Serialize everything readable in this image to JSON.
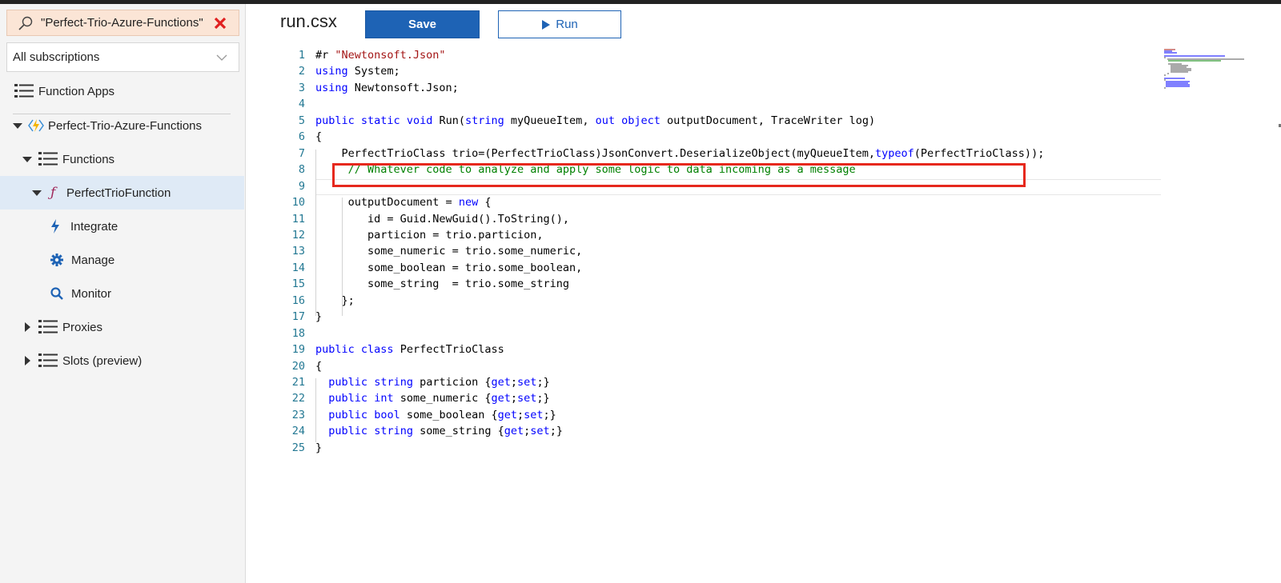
{
  "sidebar": {
    "search_value": "\"Perfect-Trio-Azure-Functions\"",
    "subscriptions": "All subscriptions",
    "items": [
      {
        "label": "Function Apps"
      },
      {
        "label": "Perfect-Trio-Azure-Functions"
      },
      {
        "label": "Functions"
      },
      {
        "label": "PerfectTrioFunction"
      },
      {
        "label": "Integrate"
      },
      {
        "label": "Manage"
      },
      {
        "label": "Monitor"
      },
      {
        "label": "Proxies"
      },
      {
        "label": "Slots (preview)"
      }
    ]
  },
  "editor": {
    "filename": "run.csx",
    "save_label": "Save",
    "run_label": "Run",
    "lines": [
      {
        "n": "1",
        "t": "#r \"Newtonsoft.Json\""
      },
      {
        "n": "2",
        "t": "using System;"
      },
      {
        "n": "3",
        "t": "using Newtonsoft.Json;"
      },
      {
        "n": "4",
        "t": ""
      },
      {
        "n": "5",
        "t": "public static void Run(string myQueueItem, out object outputDocument, TraceWriter log)"
      },
      {
        "n": "6",
        "t": "{"
      },
      {
        "n": "7",
        "t": "    PerfectTrioClass trio=(PerfectTrioClass)JsonConvert.DeserializeObject(myQueueItem,typeof(PerfectTrioClass));"
      },
      {
        "n": "8",
        "t": "     // Whatever code to analyze and apply some logic to data incoming as a message"
      },
      {
        "n": "9",
        "t": ""
      },
      {
        "n": "10",
        "t": "     outputDocument = new {"
      },
      {
        "n": "11",
        "t": "        id = Guid.NewGuid().ToString(),"
      },
      {
        "n": "12",
        "t": "        particion = trio.particion,"
      },
      {
        "n": "13",
        "t": "        some_numeric = trio.some_numeric,"
      },
      {
        "n": "14",
        "t": "        some_boolean = trio.some_boolean,"
      },
      {
        "n": "15",
        "t": "        some_string  = trio.some_string"
      },
      {
        "n": "16",
        "t": "    };"
      },
      {
        "n": "17",
        "t": "}"
      },
      {
        "n": "18",
        "t": ""
      },
      {
        "n": "19",
        "t": "public class PerfectTrioClass"
      },
      {
        "n": "20",
        "t": "{"
      },
      {
        "n": "21",
        "t": "  public string particion {get;set;}"
      },
      {
        "n": "22",
        "t": "  public int some_numeric {get;set;}"
      },
      {
        "n": "23",
        "t": "  public bool some_boolean {get;set;}"
      },
      {
        "n": "24",
        "t": "  public string some_string {get;set;}"
      },
      {
        "n": "25",
        "t": "}"
      }
    ]
  }
}
